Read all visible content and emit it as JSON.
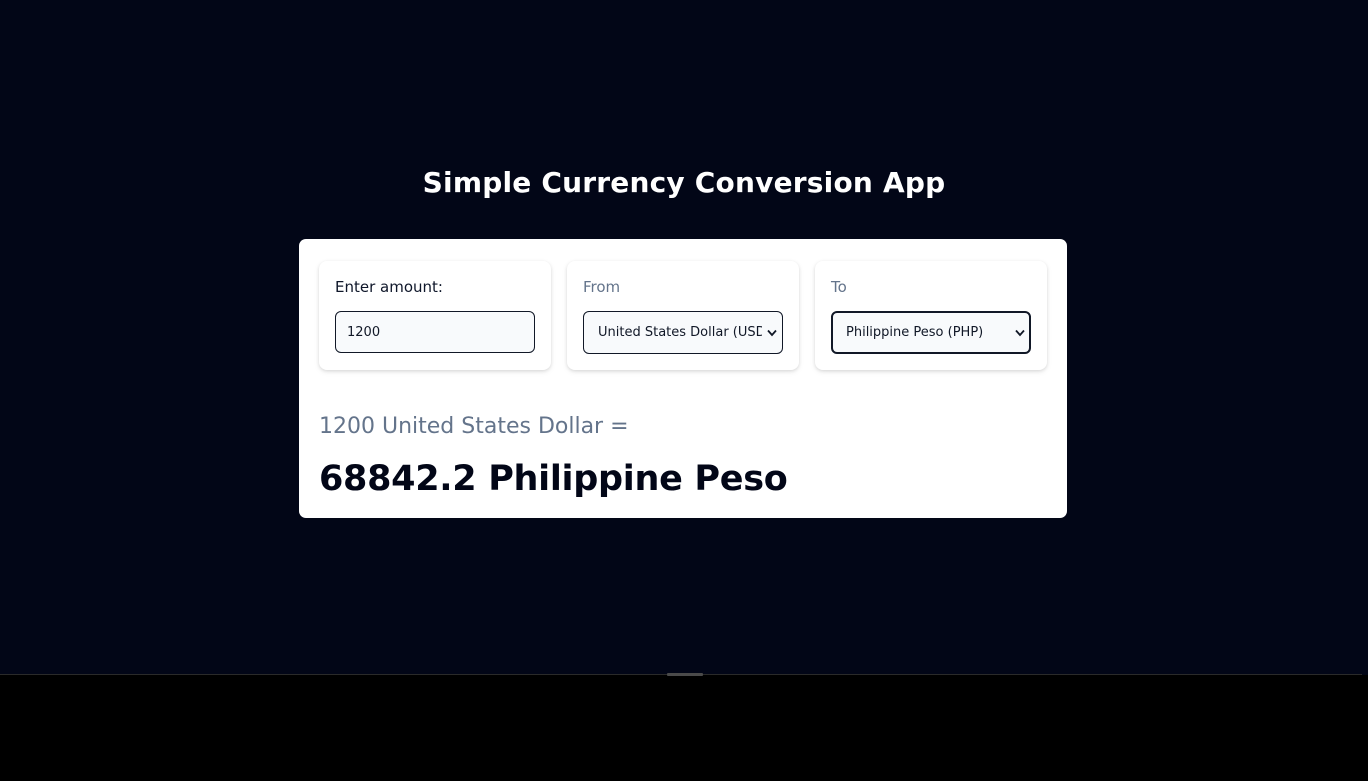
{
  "app": {
    "title": "Simple Currency Conversion App"
  },
  "amount": {
    "label": "Enter amount:",
    "value": "1200"
  },
  "from": {
    "label": "From",
    "selected": "United States Dollar (USD)"
  },
  "to": {
    "label": "To",
    "selected": "Philippine Peso (PHP)"
  },
  "result": {
    "from_line": "1200 United States Dollar =",
    "to_line": "68842.2 Philippine Peso"
  },
  "icons": {
    "select_arrow": "chevron-down-icon"
  },
  "colors": {
    "background": "#020617",
    "card": "#ffffff",
    "muted_text": "#64748b",
    "dark_text": "#020617"
  }
}
